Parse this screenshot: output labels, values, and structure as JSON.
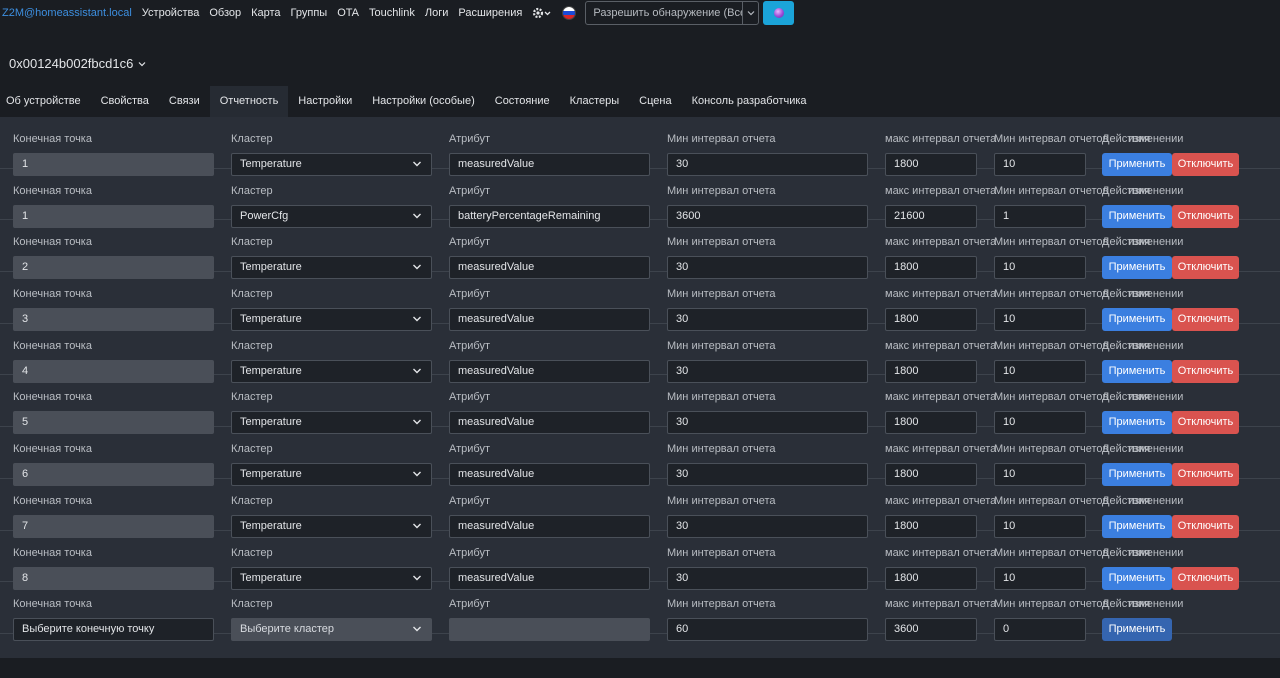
{
  "navbar": {
    "brand": "Z2M@homeassistant.local",
    "links": [
      "Устройства",
      "Обзор",
      "Карта",
      "Группы",
      "OTA",
      "Touchlink",
      "Логи",
      "Расширения"
    ],
    "permit_join_label": "Разрешить обнаружение (Все)"
  },
  "device": {
    "ieee": "0x00124b002fbcd1c6"
  },
  "tabs": [
    "Об устройстве",
    "Свойства",
    "Связи",
    "Отчетность",
    "Настройки",
    "Настройки (особые)",
    "Состояние",
    "Кластеры",
    "Сцена",
    "Консоль разработчика"
  ],
  "active_tab": "Отчетность",
  "labels": {
    "endpoint": "Конечная точка",
    "cluster": "Кластер",
    "attribute": "Атрибут",
    "min_interval": "Мин интервал отчета",
    "max_interval": "макс интервал отчета",
    "min_change": "Мин интервал отчетов",
    "actions": "Действия",
    "overlap_suffix": "изменении"
  },
  "buttons": {
    "apply": "Применить",
    "disable": "Отключить"
  },
  "rows": [
    {
      "endpoint": "1",
      "cluster": "Temperature",
      "attribute": "measuredValue",
      "min": "30",
      "max": "1800",
      "change": "10"
    },
    {
      "endpoint": "1",
      "cluster": "PowerCfg",
      "attribute": "batteryPercentageRemaining",
      "min": "3600",
      "max": "21600",
      "change": "1"
    },
    {
      "endpoint": "2",
      "cluster": "Temperature",
      "attribute": "measuredValue",
      "min": "30",
      "max": "1800",
      "change": "10"
    },
    {
      "endpoint": "3",
      "cluster": "Temperature",
      "attribute": "measuredValue",
      "min": "30",
      "max": "1800",
      "change": "10"
    },
    {
      "endpoint": "4",
      "cluster": "Temperature",
      "attribute": "measuredValue",
      "min": "30",
      "max": "1800",
      "change": "10"
    },
    {
      "endpoint": "5",
      "cluster": "Temperature",
      "attribute": "measuredValue",
      "min": "30",
      "max": "1800",
      "change": "10"
    },
    {
      "endpoint": "6",
      "cluster": "Temperature",
      "attribute": "measuredValue",
      "min": "30",
      "max": "1800",
      "change": "10"
    },
    {
      "endpoint": "7",
      "cluster": "Temperature",
      "attribute": "measuredValue",
      "min": "30",
      "max": "1800",
      "change": "10"
    },
    {
      "endpoint": "8",
      "cluster": "Temperature",
      "attribute": "measuredValue",
      "min": "30",
      "max": "1800",
      "change": "10"
    }
  ],
  "new_row": {
    "endpoint_placeholder": "Выберите конечную точку",
    "cluster_placeholder": "Выберите кластер",
    "attribute": "",
    "min": "60",
    "max": "3600",
    "change": "0"
  },
  "colors": {
    "primary": "#3b7fe0",
    "danger": "#d9534f",
    "brand": "#3d8fe0",
    "panel": "#2a2f38"
  }
}
